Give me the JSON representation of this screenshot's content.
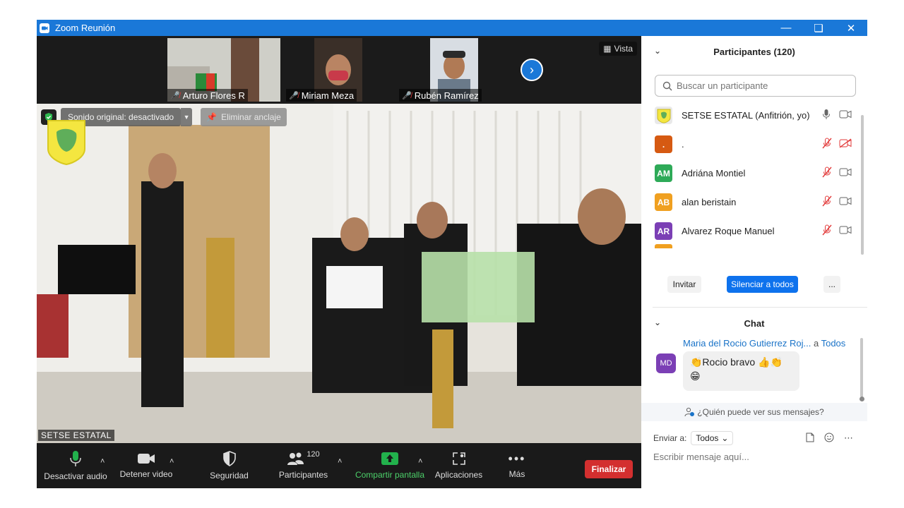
{
  "window": {
    "title": "Zoom Reunión",
    "controls": [
      "minimize",
      "restore",
      "close"
    ]
  },
  "thumbnails": [
    {
      "name": "Arturo Flores R",
      "muted": true
    },
    {
      "name": "Miriam Meza",
      "muted": true
    },
    {
      "name": "Rubén Ramírez",
      "muted": true
    }
  ],
  "view_button": "Vista",
  "main_video": {
    "speaker_name": "SETSE ESTATAL",
    "original_sound": "Sonido original: desactivado",
    "unpin": "Eliminar anclaje"
  },
  "toolbar": {
    "audio": "Desactivar audio",
    "video": "Detener video",
    "security": "Seguridad",
    "participants": "Participantes",
    "participants_count": "120",
    "share": "Compartir pantalla",
    "apps": "Aplicaciones",
    "more": "Más",
    "end": "Finalizar"
  },
  "participants_panel": {
    "title": "Participantes (120)",
    "search_placeholder": "Buscar un participante",
    "items": [
      {
        "initials": "",
        "name": "SETSE ESTATAL (Anfitrión, yo)",
        "color": "#e9e9e9",
        "mic": "on",
        "cam": "on"
      },
      {
        "initials": ".",
        "name": ".",
        "color": "#d65a12",
        "mic": "off",
        "cam": "off"
      },
      {
        "initials": "AM",
        "name": "Adriána Montiel",
        "color": "#2eaa58",
        "mic": "off",
        "cam": "on"
      },
      {
        "initials": "AB",
        "name": "alan beristain",
        "color": "#f0a020",
        "mic": "off",
        "cam": "on"
      },
      {
        "initials": "AR",
        "name": "Alvarez Roque Manuel",
        "color": "#7b3fb5",
        "mic": "off",
        "cam": "on"
      }
    ],
    "invite": "Invitar",
    "mute_all": "Silenciar a todos",
    "more": "..."
  },
  "chat": {
    "title": "Chat",
    "message": {
      "sender": "Maria del Rocio Gutierrez Roj...",
      "to_prefix": "a",
      "to": "Todos",
      "initials": "MD",
      "text_line1": "👏Rocio bravo 👍👏",
      "text_line2": "😁"
    },
    "who_can_see": "¿Quién puede ver sus mensajes?",
    "send_to_label": "Enviar a:",
    "send_to_value": "Todos",
    "input_placeholder": "Escribir mensaje aquí..."
  },
  "colors": {
    "title_bar": "#1a78d8",
    "end_button": "#d32f2f",
    "share_green": "#22b14c",
    "mute_all_blue": "#0e72ed",
    "mic_off_red": "#e23a3a"
  }
}
